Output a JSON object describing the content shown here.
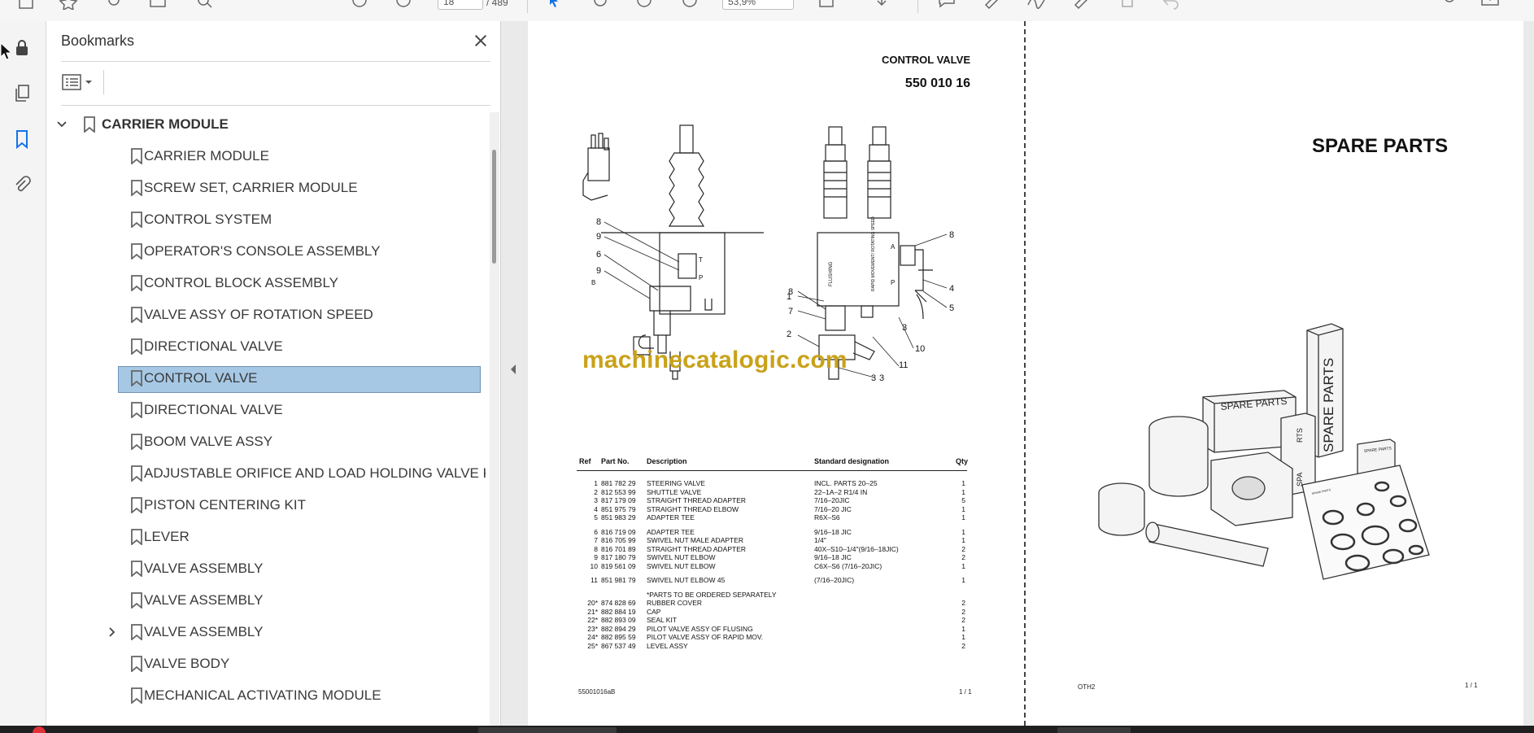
{
  "toolbar": {
    "page_current": "18",
    "page_total": "/ 489",
    "zoom": "53,9%"
  },
  "panel": {
    "title": "Bookmarks",
    "items": [
      {
        "label": "CARRIER MODULE",
        "level": 0,
        "expanded": true
      },
      {
        "label": "CARRIER MODULE",
        "level": 1
      },
      {
        "label": "SCREW SET, CARRIER MODULE",
        "level": 1
      },
      {
        "label": "CONTROL SYSTEM",
        "level": 1
      },
      {
        "label": "OPERATOR'S CONSOLE ASSEMBLY",
        "level": 1
      },
      {
        "label": "CONTROL BLOCK ASSEMBLY",
        "level": 1
      },
      {
        "label": "VALVE ASSY OF ROTATION SPEED",
        "level": 1
      },
      {
        "label": "DIRECTIONAL VALVE",
        "level": 1
      },
      {
        "label": "CONTROL VALVE",
        "level": 1,
        "selected": true
      },
      {
        "label": "DIRECTIONAL VALVE",
        "level": 1
      },
      {
        "label": "BOOM VALVE ASSY",
        "level": 1
      },
      {
        "label": "ADJUSTABLE ORIFICE AND LOAD HOLDING VALVE KIT",
        "level": 1
      },
      {
        "label": "PISTON CENTERING KIT",
        "level": 1
      },
      {
        "label": "LEVER",
        "level": 1
      },
      {
        "label": "VALVE ASSEMBLY",
        "level": 1
      },
      {
        "label": "VALVE ASSEMBLY",
        "level": 1
      },
      {
        "label": "VALVE ASSEMBLY",
        "level": 1,
        "collapsed": true
      },
      {
        "label": "VALVE BODY",
        "level": 1
      },
      {
        "label": "MECHANICAL ACTIVATING MODULE",
        "level": 1
      }
    ]
  },
  "page1": {
    "title": "CONTROL VALVE",
    "part_number": "550 010 16",
    "watermark": "machinecatalogic.com",
    "callouts": [
      "8",
      "9",
      "6",
      "9",
      "B",
      "T",
      "P",
      "1",
      "8",
      "7",
      "2",
      "3",
      "3",
      "4",
      "5",
      "10",
      "11",
      "8",
      "A",
      "P",
      "FLUSHING",
      "RAPID MOVEMENT/ ROTATING SPEED",
      "3"
    ],
    "table": {
      "headers": {
        "ref": "Ref",
        "part": "Part No.",
        "desc": "Description",
        "std": "Standard designation",
        "qty": "Qty"
      },
      "groups": [
        [
          {
            "ref": "1",
            "part": "881 782 29",
            "desc": "STEERING VALVE",
            "std": "INCL. PARTS 20–25",
            "qty": "1"
          },
          {
            "ref": "2",
            "part": "812 553 99",
            "desc": "SHUTTLE VALVE",
            "std": "22–1A–2 R1/4 IN",
            "qty": "1"
          },
          {
            "ref": "3",
            "part": "817 179 09",
            "desc": "STRAIGHT THREAD ADAPTER",
            "std": "7/16–20JIC",
            "qty": "5"
          },
          {
            "ref": "4",
            "part": "851 975 79",
            "desc": "STRAIGHT THREAD ELBOW",
            "std": "7/16–20 JIC",
            "qty": "1"
          },
          {
            "ref": "5",
            "part": "851 983 29",
            "desc": "ADAPTER TEE",
            "std": "R6X–S6",
            "qty": "1"
          }
        ],
        [
          {
            "ref": "6",
            "part": "816 719 09",
            "desc": "ADAPTER TEE",
            "std": "9/16–18 JIC",
            "qty": "1"
          },
          {
            "ref": "7",
            "part": "816 705 99",
            "desc": "SWIVEL NUT MALE ADAPTER",
            "std": "1/4\"",
            "qty": "1"
          },
          {
            "ref": "8",
            "part": "816 701 89",
            "desc": "STRAIGHT THREAD ADAPTER",
            "std": "40X–S10–1/4\"(9/16–18JIC)",
            "qty": "2"
          },
          {
            "ref": "9",
            "part": "817 180 79",
            "desc": "SWIVEL NUT ELBOW",
            "std": "9/16–18 JIC",
            "qty": "2"
          },
          {
            "ref": "10",
            "part": "819 561 09",
            "desc": "SWIVEL NUT ELBOW",
            "std": "C6X–S6 (7/16–20JIC)",
            "qty": "1"
          }
        ],
        [
          {
            "ref": "11",
            "part": "851 981 79",
            "desc": "SWIVEL NUT ELBOW 45",
            "std": "(7/16–20JIC)",
            "qty": "1"
          }
        ],
        [
          {
            "ref": "",
            "part": "",
            "desc": "*PARTS TO BE ORDERED SEPARATELY",
            "std": "",
            "qty": ""
          },
          {
            "ref": "20*",
            "part": "874 828 69",
            "desc": "RUBBER COVER",
            "std": "",
            "qty": "2"
          },
          {
            "ref": "21*",
            "part": "882 884 19",
            "desc": "CAP",
            "std": "",
            "qty": "2"
          },
          {
            "ref": "22*",
            "part": "882 893 09",
            "desc": "SEAL KIT",
            "std": "",
            "qty": "2"
          },
          {
            "ref": "23*",
            "part": "882 894 29",
            "desc": "PILOT VALVE ASSY OF FLUSING",
            "std": "",
            "qty": "1"
          },
          {
            "ref": "24*",
            "part": "882 895 59",
            "desc": "PILOT VALVE ASSY OF RAPID MOV.",
            "std": "",
            "qty": "1"
          },
          {
            "ref": "25*",
            "part": "867 537 49",
            "desc": "LEVEL ASSY",
            "std": "",
            "qty": "2"
          }
        ]
      ]
    },
    "footer_left": "55001016aB",
    "footer_right": "1 /  1"
  },
  "page2": {
    "title": "SPARE PARTS",
    "box_labels": [
      "SPARE PARTS",
      "SPARE PARTS",
      "RTS",
      "SPA",
      "SPARE PARTS",
      "SPARE PARTS"
    ],
    "footer_left": "OTH2",
    "footer_right": "1 /  1"
  },
  "colors": {
    "selection": "#a6c8e4",
    "accent": "#1473e6",
    "watermark": "#c9a21a",
    "taskbar": "#202020"
  },
  "icons": {
    "rail": [
      "lock-icon",
      "pages-icon",
      "bookmark-icon",
      "paperclip-icon"
    ],
    "toolbar": [
      "save-icon",
      "star-icon",
      "share-icon",
      "print-icon",
      "search-icon",
      "prev-page-icon",
      "next-page-icon",
      "cursor-icon",
      "hand-icon",
      "zoom-out-icon",
      "zoom-in-icon",
      "fit-page-icon",
      "scroll-icon",
      "comment-icon",
      "highlight-icon",
      "sign-icon",
      "draw-icon",
      "delete-icon",
      "undo-icon",
      "account-icon",
      "mail-icon"
    ]
  }
}
